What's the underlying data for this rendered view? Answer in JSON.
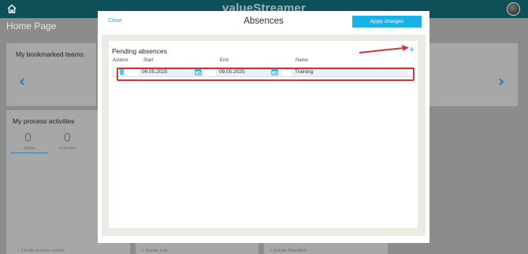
{
  "app": {
    "logo_text": "valueStreamer",
    "page_title": "Home Page"
  },
  "background": {
    "bookmarks_title": "My bookmarked teams",
    "process_title": "My process activities",
    "stats": [
      {
        "value": "0",
        "label": "Active"
      },
      {
        "value": "0",
        "label": "Overdue"
      }
    ],
    "footer_links": [
      "+ Create process activity",
      "+ Create task",
      "+ Create Deviation"
    ]
  },
  "modal": {
    "close_label": "Close",
    "title": "Absences",
    "apply_label": "Apply changes",
    "panel_title": "Pending absences",
    "add_icon": "+",
    "columns": [
      "Actions",
      "Start",
      "End",
      "Name"
    ],
    "rows": [
      {
        "start": "06.05.2025",
        "end": "09.05.2025",
        "name": "Training"
      }
    ]
  },
  "colors": {
    "accent": "#18b2e6",
    "highlight": "#d5323b",
    "topbar": "#0f4f58"
  }
}
